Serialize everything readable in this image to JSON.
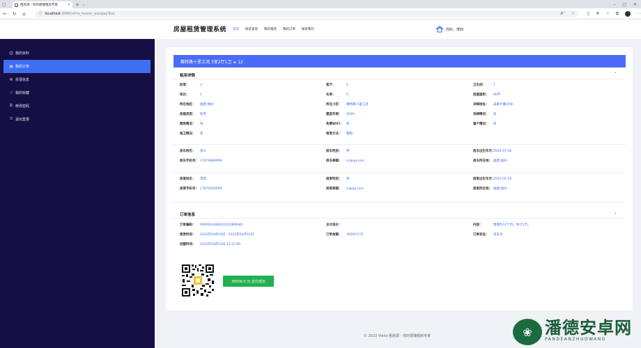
{
  "browser": {
    "tab_title": "租房源 - 你的便捷租房专家",
    "url_host": "localhost",
    "url_path": ":9090/vtrie_house_war/payTest"
  },
  "header": {
    "logo": "房屋租赁管理系统",
    "nav": [
      "首页",
      "找近查询",
      "我的租赁",
      "我的订单",
      "联系我们"
    ],
    "user_greeting": "你好，李四"
  },
  "sidebar": {
    "items": [
      {
        "icon": "user-icon",
        "label": "我的资料"
      },
      {
        "icon": "order-icon",
        "label": "我的订单"
      },
      {
        "icon": "feedback-icon",
        "label": "反馈信息"
      },
      {
        "icon": "favorite-icon",
        "label": "我的收藏"
      },
      {
        "icon": "password-icon",
        "label": "修改密码"
      },
      {
        "icon": "logout-icon",
        "label": "退出登录"
      }
    ]
  },
  "main": {
    "house_title": "赛特路十里江湾 3室2厅1卫 ≥ 12",
    "house_section_title": "租用详情",
    "house_fields": [
      {
        "k": "卧室：",
        "v": "3"
      },
      {
        "k": "客厅：",
        "v": "2"
      },
      {
        "k": "卫生间：",
        "v": "1"
      },
      {
        "k": "阳台：",
        "v": "2"
      },
      {
        "k": "车库：",
        "v": "0"
      },
      {
        "k": "房屋面积：",
        "v": "80平"
      },
      {
        "k": "所在地区：",
        "v": "福建-福州"
      },
      {
        "k": "所在小区：",
        "v": "赛特路十里江湾"
      },
      {
        "k": "详细地址：",
        "v": "美联大厦40号"
      },
      {
        "k": "房屋类型：",
        "v": "住宅"
      },
      {
        "k": "建造年限：",
        "v": "2000"
      },
      {
        "k": "电梯情况：",
        "v": "有"
      },
      {
        "k": "厨房情况：",
        "v": "有"
      },
      {
        "k": "免费WiFi：",
        "v": "有"
      },
      {
        "k": "窗户情况：",
        "v": "有"
      },
      {
        "k": "独卫情况：",
        "v": "有"
      },
      {
        "k": "租赁方式：",
        "v": "整租"
      }
    ],
    "landlord_fields": [
      {
        "k": "房东姓名：",
        "v": "张三"
      },
      {
        "k": "房东性别：",
        "v": "男"
      },
      {
        "k": "房东出生年月：",
        "v": "2002-07-28"
      },
      {
        "k": "房东手机号：",
        "v": "17878888909"
      },
      {
        "k": "房东邮箱：",
        "v": "zs@qq.com"
      },
      {
        "k": "房东所在地：",
        "v": "福建-福州"
      }
    ],
    "tenant_fields": [
      {
        "k": "房客姓名：",
        "v": "李四"
      },
      {
        "k": "房客性别：",
        "v": "男"
      },
      {
        "k": "房客出生年月：",
        "v": "2001-05-18"
      },
      {
        "k": "房客手机号：",
        "v": "17879540000"
      },
      {
        "k": "房客邮箱：",
        "v": "ls@qq.com"
      },
      {
        "k": "房客所在地：",
        "v": "福建-福州"
      }
    ],
    "order_section_title": "订单信息",
    "order_fields": [
      {
        "k": "订单编码：",
        "v": "09009144860202208964J6"
      },
      {
        "k": "支付流水：",
        "v": ""
      },
      {
        "k": "内容：",
        "v": "租期为12个月，共计1万。"
      },
      {
        "k": "租赁时间：",
        "v": "2022年04月14日 - 2023年04月14日"
      },
      {
        "k": "订单金额：",
        "v": "30000.0 元"
      },
      {
        "k": "订单状态：",
        "v": "未支付"
      },
      {
        "k": "创建时间：",
        "v": "2022年04月14日 12:22:00"
      }
    ],
    "pay_button": "30000.0 元 支付成功"
  },
  "footer": "© 2022 Vielio 租房源 - 你的便捷租房专家",
  "watermark": {
    "big": "潘德安卓网",
    "small": "PANDEANZHUOWANG"
  }
}
